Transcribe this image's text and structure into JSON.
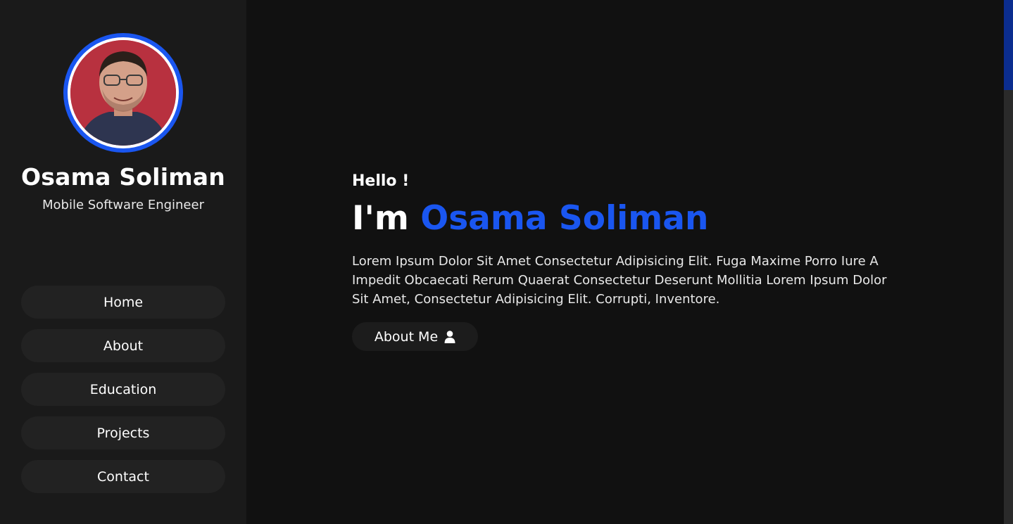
{
  "sidebar": {
    "name": "Osama Soliman",
    "role": "Mobile Software Engineer",
    "nav": [
      {
        "label": "Home"
      },
      {
        "label": "About"
      },
      {
        "label": "Education"
      },
      {
        "label": "Projects"
      },
      {
        "label": "Contact"
      }
    ]
  },
  "hero": {
    "greeting": "Hello !",
    "intro_prefix": "I'm",
    "intro_name": "Osama Soliman",
    "description": "Lorem Ipsum Dolor Sit Amet Consectetur Adipisicing Elit. Fuga Maxime Porro Iure A Impedit Obcaecati Rerum Quaerat Consectetur Deserunt Mollitia Lorem Ipsum Dolor Sit Amet, Consectetur Adipisicing Elit. Corrupti, Inventore.",
    "button_label": "About Me",
    "button_icon": "user-icon"
  },
  "colors": {
    "accent": "#1a56f0",
    "background": "#111111",
    "sidebar": "#1a1a1a"
  }
}
